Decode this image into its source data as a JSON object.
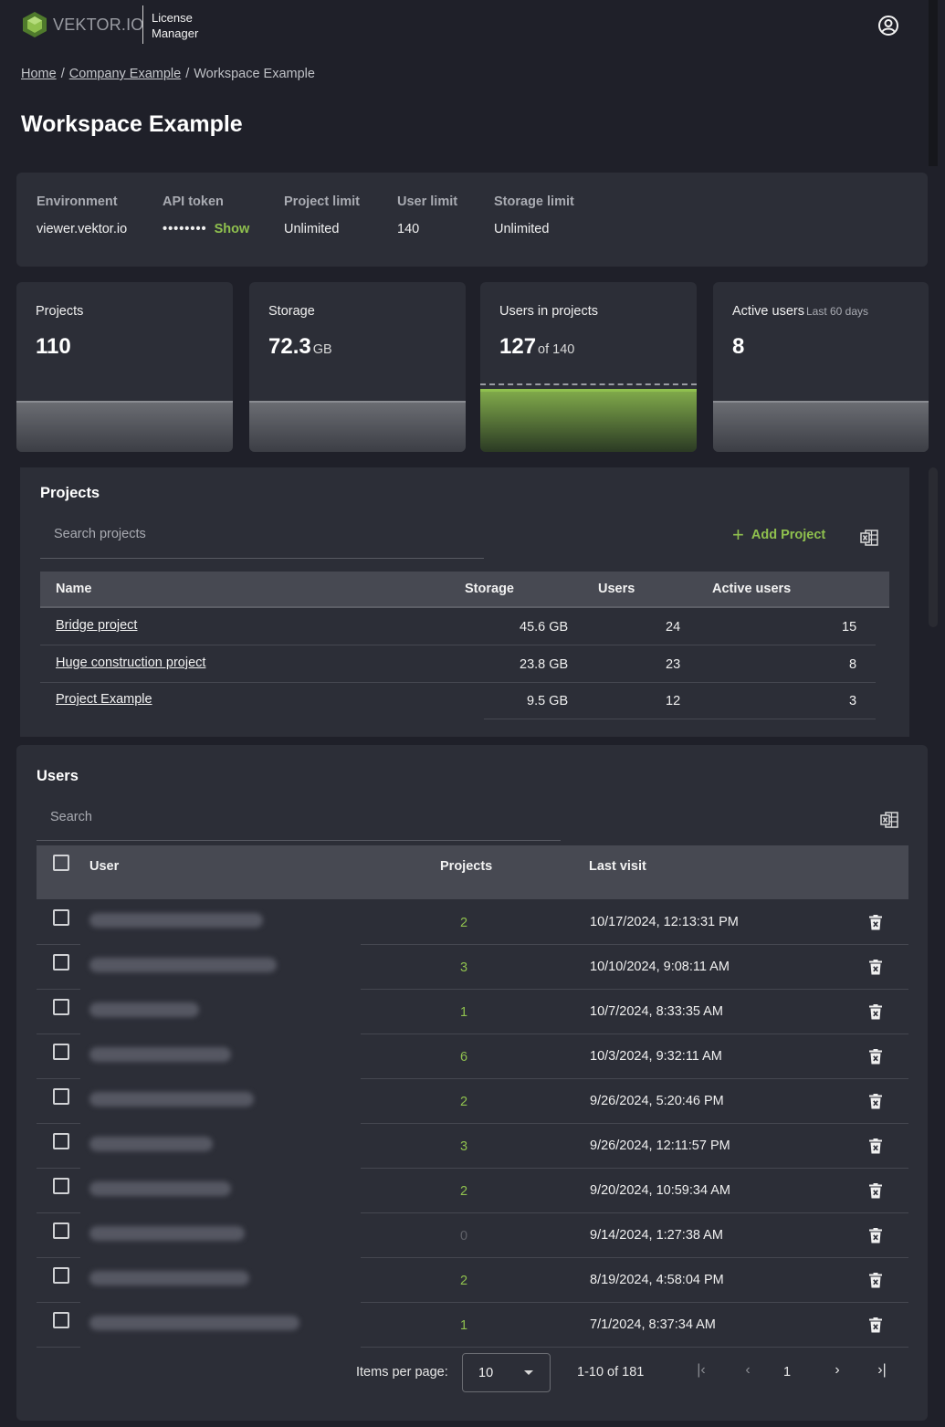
{
  "header": {
    "brand": "VEKTOR.IO",
    "product_line1": "License",
    "product_line2": "Manager",
    "account_icon": "account-circle-icon"
  },
  "breadcrumb": {
    "home": "Home",
    "company": "Company Example",
    "current": "Workspace Example",
    "separator": "/"
  },
  "page_title": "Workspace Example",
  "info": {
    "environment_label": "Environment",
    "environment_value": "viewer.vektor.io",
    "api_label": "API token",
    "api_value": "••••••••",
    "api_show": "Show",
    "project_limit_label": "Project limit",
    "project_limit_value": "Unlimited",
    "user_limit_label": "User limit",
    "user_limit_value": "140",
    "storage_limit_label": "Storage limit",
    "storage_limit_value": "Unlimited"
  },
  "stats": {
    "projects_label": "Projects",
    "projects_value": "110",
    "storage_label": "Storage",
    "storage_value": "72.3",
    "storage_unit": "GB",
    "users_label": "Users in projects",
    "users_value": "127",
    "users_of": "of 140",
    "users_fill_fraction": 0.907,
    "active_label": "Active users",
    "active_sub": "Last 60 days",
    "active_value": "8"
  },
  "projects": {
    "title": "Projects",
    "search_placeholder": "Search projects",
    "add_label": "Add Project",
    "columns": [
      "Name",
      "Storage",
      "Users",
      "Active users"
    ],
    "rows": [
      {
        "name": "Bridge project",
        "storage": "45.6 GB",
        "users": "24",
        "active": "15"
      },
      {
        "name": "Huge construction project",
        "storage": "23.8 GB",
        "users": "23",
        "active": "8"
      },
      {
        "name": "Project Example",
        "storage": "9.5 GB",
        "users": "12",
        "active": "3"
      }
    ]
  },
  "users": {
    "title": "Users",
    "search_placeholder": "Search",
    "columns": [
      "User",
      "Projects",
      "Last visit"
    ],
    "rows": [
      {
        "projects": "2",
        "last_visit": "10/17/2024, 12:13:31 PM"
      },
      {
        "projects": "3",
        "last_visit": "10/10/2024, 9:08:11 AM"
      },
      {
        "projects": "1",
        "last_visit": "10/7/2024, 8:33:35 AM"
      },
      {
        "projects": "6",
        "last_visit": "10/3/2024, 9:32:11 AM"
      },
      {
        "projects": "2",
        "last_visit": "9/26/2024, 5:20:46 PM"
      },
      {
        "projects": "3",
        "last_visit": "9/26/2024, 12:11:57 PM"
      },
      {
        "projects": "2",
        "last_visit": "9/20/2024, 10:59:34 AM"
      },
      {
        "projects": "0",
        "last_visit": "9/14/2024, 1:27:38 AM"
      },
      {
        "projects": "2",
        "last_visit": "8/19/2024, 4:58:04 PM"
      },
      {
        "projects": "1",
        "last_visit": "7/1/2024, 8:37:34 AM"
      }
    ],
    "pager": {
      "items_label": "Items per page:",
      "items_value": "10",
      "range": "1-10 of 181",
      "page": "1"
    }
  },
  "colors": {
    "accent": "#8fc04e",
    "background": "#1f2029",
    "card": "#2c2e37",
    "table_header": "#474952"
  }
}
